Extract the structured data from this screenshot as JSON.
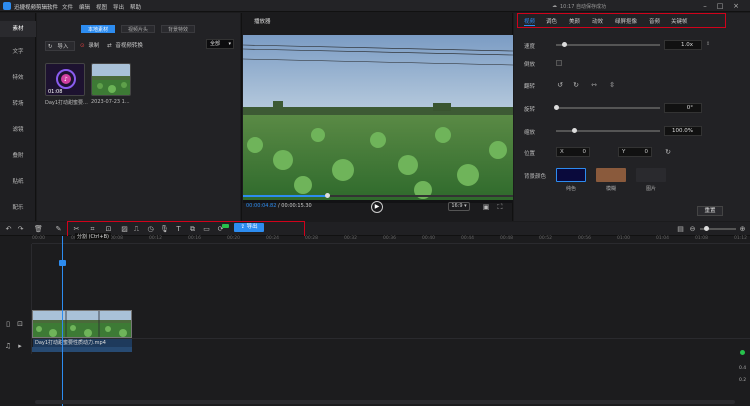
{
  "app": {
    "title": "迅捷视频剪辑软件",
    "saved_status": "10:17 自动保存成功"
  },
  "menu": [
    "文件",
    "编辑",
    "视图",
    "导出",
    "帮助"
  ],
  "nav": [
    {
      "label": "素材",
      "active": true
    },
    {
      "label": "文字",
      "active": false
    },
    {
      "label": "特效",
      "active": false
    },
    {
      "label": "转场",
      "active": false
    },
    {
      "label": "滤镜",
      "active": false
    },
    {
      "label": "叠附",
      "active": false
    },
    {
      "label": "贴纸",
      "active": false
    },
    {
      "label": "配乐",
      "active": false
    }
  ],
  "media": {
    "subtabs": [
      "本地素材",
      "视频片头",
      "背景特效"
    ],
    "import_label": "导入",
    "record_label": "录制",
    "convert_label": "音视频转换",
    "filter_value": "全部",
    "clips": [
      {
        "name": "Day1打动甜蜜要...",
        "duration": "01:08"
      },
      {
        "name": "2023-07-23 1...",
        "duration": ""
      }
    ]
  },
  "player": {
    "title": "播放器",
    "current_time": "00:00:04.82",
    "total_time": "00:00:15.30",
    "progress_percent": 31,
    "aspect_ratio": "16:9"
  },
  "properties": {
    "tabs": [
      "视频",
      "调色",
      "美颜",
      "动效",
      "绿屏抠像",
      "音频",
      "关键帧"
    ],
    "active_tab": "视频",
    "speed_label": "速度",
    "speed_value": "1.0x",
    "speed_level": 0.08,
    "reverse_label": "倒放",
    "flip_label": "翻转",
    "rotate_label": "旋转",
    "rotate_value": "0°",
    "rotate_level": 0.0,
    "scale_label": "缩放",
    "scale_value": "100.0%",
    "scale_level": 0.17,
    "position_label": "位置",
    "pos_x_label": "X",
    "pos_x_value": "0",
    "pos_y_label": "Y",
    "pos_y_value": "0",
    "bg_color_label": "背景颜色",
    "swatches": [
      {
        "label": "纯色",
        "color": "#0a0a3c"
      },
      {
        "label": "模糊",
        "color": "#8a5a3c"
      },
      {
        "label": "图片",
        "color": "#2a2a2e"
      }
    ],
    "reset_label": "重置"
  },
  "timeline": {
    "export_label": "导出",
    "split_tooltip": "分割 (Ctrl+B)",
    "ruler_ticks": [
      "00:00",
      "00:04",
      "00:08",
      "00:12",
      "00:16",
      "00:20",
      "00:24",
      "00:28",
      "00:32",
      "00:36",
      "00:40",
      "00:44",
      "00:48",
      "00:52",
      "00:56",
      "01:00",
      "01:04",
      "01:08",
      "01:12"
    ],
    "clip_name": "Day1打动甜蜜要性质动力.mp4",
    "meter_values": [
      "0.4",
      "0.2"
    ]
  },
  "colors": {
    "accent": "#2d8cf0",
    "highlight_box": "#d0021b",
    "green_badge": "#27c24c"
  }
}
